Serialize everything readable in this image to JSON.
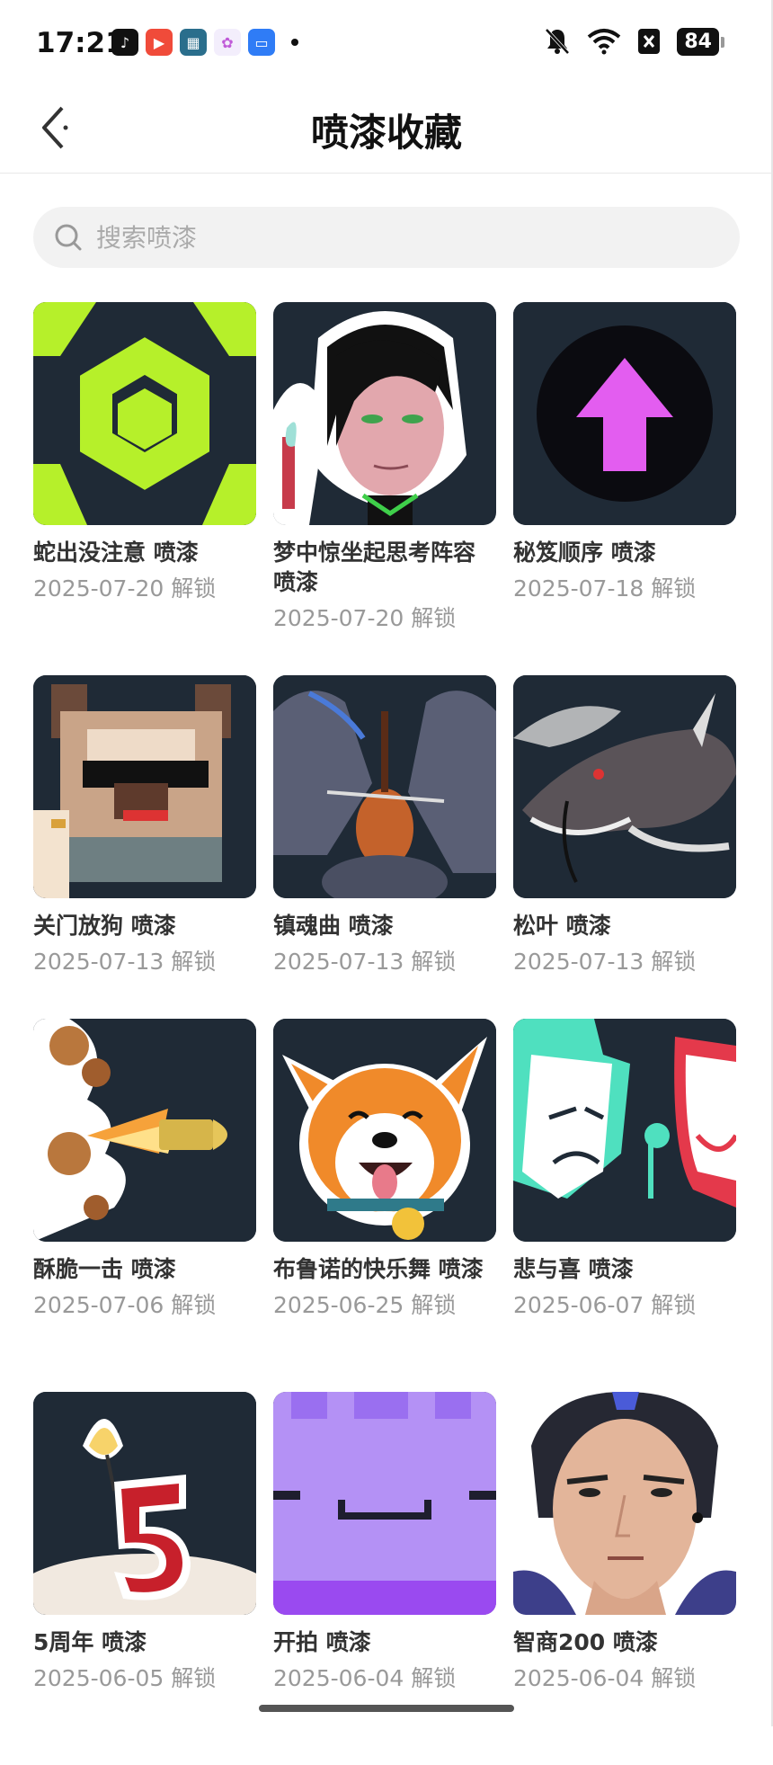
{
  "status_bar": {
    "time": "17:21",
    "battery": "84",
    "app_icons": [
      "tiktok-icon",
      "video-app-icon",
      "game-app-icon",
      "flower-app-icon",
      "blue-app-icon"
    ]
  },
  "header": {
    "title": "喷漆收藏"
  },
  "search": {
    "placeholder": "搜索喷漆"
  },
  "items": [
    {
      "name": "蛇出没注意 喷漆",
      "date": "2025-07-20 解锁",
      "icon": "hexagon-spray"
    },
    {
      "name": "梦中惊坐起思考阵容 喷漆",
      "date": "2025-07-20 解锁",
      "icon": "viper-spray"
    },
    {
      "name": "秘笈顺序 喷漆",
      "date": "2025-07-18 解锁",
      "icon": "arrow-up-spray"
    },
    {
      "name": "关门放狗 喷漆",
      "date": "2025-07-13 解锁",
      "icon": "pixel-dog-spray"
    },
    {
      "name": "镇魂曲 喷漆",
      "date": "2025-07-13 解锁",
      "icon": "violin-spray"
    },
    {
      "name": "松叶 喷漆",
      "date": "2025-07-13 解锁",
      "icon": "catfish-spray"
    },
    {
      "name": "酥脆一击 喷漆",
      "date": "2025-07-06 解锁",
      "icon": "bullet-spray"
    },
    {
      "name": "布鲁诺的快乐舞 喷漆",
      "date": "2025-06-25 解锁",
      "icon": "corgi-spray"
    },
    {
      "name": "悲与喜 喷漆",
      "date": "2025-06-07 解锁",
      "icon": "masks-spray"
    },
    {
      "name": "5周年 喷漆",
      "date": "2025-06-05 解锁",
      "icon": "candle-5-spray"
    },
    {
      "name": "开拍 喷漆",
      "date": "2025-06-04 解锁",
      "icon": "purple-block-spray"
    },
    {
      "name": "智商200 喷漆",
      "date": "2025-06-04 解锁",
      "icon": "thinking-man-spray"
    }
  ],
  "colors": {
    "accent_lime": "#b6f02a",
    "dark_tile": "#1f2a36",
    "magenta": "#e35df0",
    "purple": "#a78bfa"
  }
}
